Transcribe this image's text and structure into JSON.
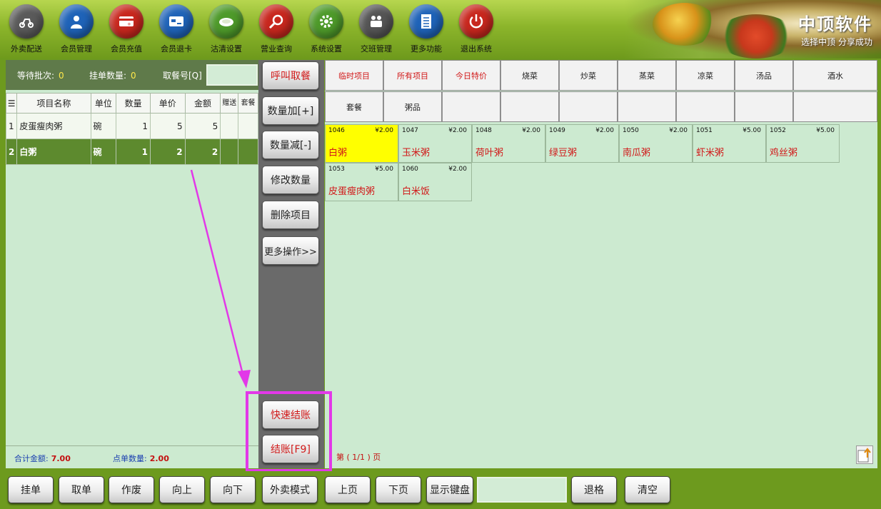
{
  "toolbar": {
    "items": [
      {
        "label": "外卖配送",
        "icon": "delivery-scooter-icon",
        "color": "#5a5a5a"
      },
      {
        "label": "会员管理",
        "icon": "member-user-icon",
        "color": "#1f63b8"
      },
      {
        "label": "会员充值",
        "icon": "recharge-card-icon",
        "color": "#c8271e"
      },
      {
        "label": "会员退卡",
        "icon": "card-return-icon",
        "color": "#1f63b8"
      },
      {
        "label": "沽清设置",
        "icon": "plate-icon",
        "color": "#4e9a2a"
      },
      {
        "label": "营业查询",
        "icon": "magnifier-icon",
        "color": "#c8271e"
      },
      {
        "label": "系统设置",
        "icon": "gear-icon",
        "color": "#4e9a2a"
      },
      {
        "label": "交班管理",
        "icon": "staff-icon",
        "color": "#555555"
      },
      {
        "label": "更多功能",
        "icon": "list-document-icon",
        "color": "#1f63b8"
      },
      {
        "label": "退出系统",
        "icon": "power-icon",
        "color": "#c8271e"
      }
    ]
  },
  "brand": {
    "name": "中顶软件",
    "slogan": "选择中顶 分享成功"
  },
  "left": {
    "waiting_label": "等待批次:",
    "waiting_value": "0",
    "hold_label": "挂单数量:",
    "hold_value": "0",
    "pickup_label": "取餐号[Q]",
    "columns": [
      "☰",
      "项目名称",
      "单位",
      "数量",
      "单价",
      "金额",
      "赠送",
      "套餐"
    ],
    "rows": [
      {
        "idx": "1",
        "name": "皮蛋瘦肉粥",
        "unit": "碗",
        "qty": "1",
        "price": "5",
        "amount": "5"
      },
      {
        "idx": "2",
        "name": "白粥",
        "unit": "碗",
        "qty": "1",
        "price": "2",
        "amount": "2"
      }
    ],
    "total_label": "合计金额:",
    "total_value": "7.00",
    "count_label": "点单数量:",
    "count_value": "2.00"
  },
  "middle": {
    "call_label": "呼叫取餐",
    "qty_plus_label": "数量加[+]",
    "qty_minus_label": "数量减[-]",
    "edit_qty_label": "修改数量",
    "delete_label": "删除项目",
    "more_label": "更多操作>>",
    "quick_checkout_label": "快速结账",
    "checkout_label": "结账[F9]"
  },
  "categories": [
    "临时项目",
    "所有项目",
    "今日特价",
    "烧菜",
    "炒菜",
    "蒸菜",
    "凉菜",
    "汤品",
    "酒水",
    "套餐",
    "粥品",
    "",
    "",
    "",
    "",
    "",
    "",
    ""
  ],
  "items": [
    {
      "code": "1046",
      "price": "¥2.00",
      "name": "白粥"
    },
    {
      "code": "1047",
      "price": "¥2.00",
      "name": "玉米粥"
    },
    {
      "code": "1048",
      "price": "¥2.00",
      "name": "荷叶粥"
    },
    {
      "code": "1049",
      "price": "¥2.00",
      "name": "绿豆粥"
    },
    {
      "code": "1050",
      "price": "¥2.00",
      "name": "南瓜粥"
    },
    {
      "code": "1051",
      "price": "¥5.00",
      "name": "虾米粥"
    },
    {
      "code": "1052",
      "price": "¥5.00",
      "name": "鸡丝粥"
    },
    {
      "code": "1053",
      "price": "¥5.00",
      "name": "皮蛋瘦肉粥"
    },
    {
      "code": "1060",
      "price": "¥2.00",
      "name": "白米饭"
    }
  ],
  "pager": {
    "text": "第 ( 1/1 ) 页"
  },
  "bottom": {
    "buttons": [
      "挂单",
      "取单",
      "作废",
      "向上",
      "向下",
      "外卖模式",
      "上页",
      "下页",
      "显示键盘",
      "退格",
      "清空"
    ]
  }
}
